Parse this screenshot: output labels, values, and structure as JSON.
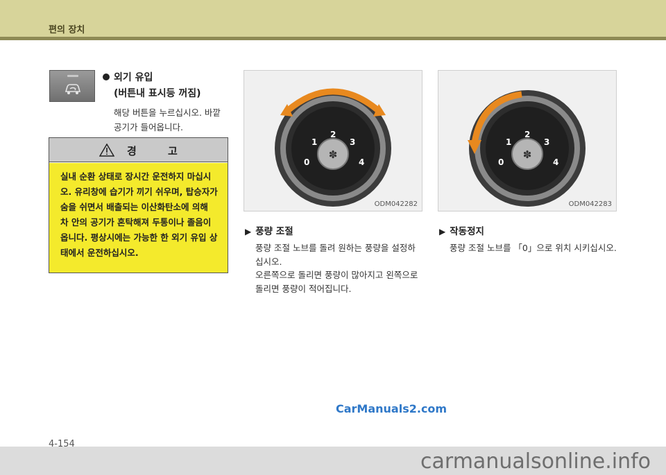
{
  "header": {
    "title": "편의 장치"
  },
  "left": {
    "item_title": "외기 유입",
    "item_sub": "(버튼내 표시등 꺼짐)",
    "item_desc_lines": [
      "해당 버튼을 누르십시오. 바깥",
      "공기가 들어옵니다."
    ],
    "button_icon": "car-air-intake-icon"
  },
  "warning": {
    "title": "경 고",
    "icon": "warning-triangle-icon",
    "lines": [
      "실내 순환 상태로 장시간 운전하지 마십시",
      "오. 유리창에 습기가 끼기 쉬우며, 탑승자가",
      "숨을 쉬면서 배출되는 이산화탄소에 의해",
      "차 안의 공기가 혼탁해져 두통이나 졸음이",
      "옵니다. 평상시에는 가능한 한 외기 유입 상",
      "태에서 운전하십시오."
    ],
    "bg_color": "#f4ea2c"
  },
  "panel1": {
    "code": "ODM042282",
    "knob_labels": [
      "0",
      "1",
      "2",
      "3",
      "4"
    ],
    "arrow": "curved-double-arrow-icon"
  },
  "panel2": {
    "code": "ODM042283",
    "knob_labels": [
      "0",
      "1",
      "2",
      "3",
      "4"
    ],
    "arrow": "curved-left-arrow-icon"
  },
  "section1": {
    "marker": "▶",
    "title": "풍량 조절",
    "lines": [
      "풍량 조절 노브를 돌려 원하는 풍량을 설정하",
      "십시오.",
      "오른쪽으로 돌리면 풍량이 많아지고 왼쪽으로",
      "돌리면 풍량이 적어집니다."
    ]
  },
  "section2": {
    "marker": "▶",
    "title": "작동정지",
    "lines": [
      "풍량 조절 노브를 「0」으로 위치 시키십시오."
    ]
  },
  "watermark": "CarManuals2.com",
  "page_number": "4-154",
  "footer_watermark": "carmanualsonline.info"
}
